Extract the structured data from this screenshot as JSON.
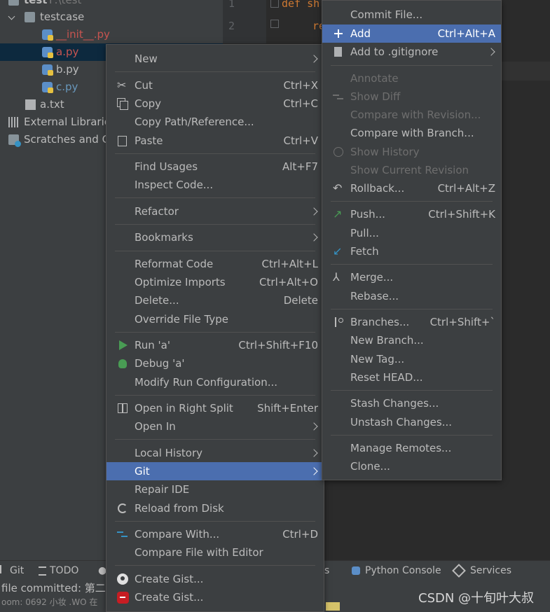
{
  "tree": {
    "root_label": "test",
    "root_path": "F:\\test",
    "folder": "testcase",
    "files": [
      {
        "name": "__init__.py",
        "color": "#c75450"
      },
      {
        "name": "a.py",
        "color": "#c75450"
      },
      {
        "name": "b.py",
        "color": "#bbbbbb"
      },
      {
        "name": "c.py",
        "color": "#6897bb"
      }
    ],
    "txt_file": "a.txt",
    "external": "External Libraries",
    "scratches": "Scratches and Consoles"
  },
  "editor": {
    "lines": [
      "1",
      "2"
    ],
    "code_line1": "def sh",
    "code_line2": "re"
  },
  "context_menu": {
    "items": [
      {
        "label": "New",
        "shortcut": "",
        "submenu": true
      },
      {
        "label": "Cut",
        "shortcut": "Ctrl+X",
        "icon": "scissors-icon"
      },
      {
        "label": "Copy",
        "shortcut": "Ctrl+C",
        "icon": "copy-icon"
      },
      {
        "label": "Copy Path/Reference...",
        "shortcut": ""
      },
      {
        "label": "Paste",
        "shortcut": "Ctrl+V",
        "icon": "paste-icon"
      },
      {
        "label": "Find Usages",
        "shortcut": "Alt+F7"
      },
      {
        "label": "Inspect Code...",
        "shortcut": ""
      },
      {
        "label": "Refactor",
        "shortcut": "",
        "submenu": true
      },
      {
        "label": "Bookmarks",
        "shortcut": "",
        "submenu": true
      },
      {
        "label": "Reformat Code",
        "shortcut": "Ctrl+Alt+L"
      },
      {
        "label": "Optimize Imports",
        "shortcut": "Ctrl+Alt+O"
      },
      {
        "label": "Delete...",
        "shortcut": "Delete"
      },
      {
        "label": "Override File Type",
        "shortcut": ""
      },
      {
        "label": "Run 'a'",
        "shortcut": "Ctrl+Shift+F10",
        "icon": "run-icon"
      },
      {
        "label": "Debug 'a'",
        "shortcut": "",
        "icon": "debug-icon"
      },
      {
        "label": "Modify Run Configuration...",
        "shortcut": ""
      },
      {
        "label": "Open in Right Split",
        "shortcut": "Shift+Enter",
        "icon": "split-icon"
      },
      {
        "label": "Open In",
        "shortcut": "",
        "submenu": true
      },
      {
        "label": "Local History",
        "shortcut": "",
        "submenu": true
      },
      {
        "label": "Git",
        "shortcut": "",
        "submenu": true,
        "highlighted": true
      },
      {
        "label": "Repair IDE",
        "shortcut": ""
      },
      {
        "label": "Reload from Disk",
        "shortcut": "",
        "icon": "reload-icon"
      },
      {
        "label": "Compare With...",
        "shortcut": "Ctrl+D",
        "icon": "compare-icon"
      },
      {
        "label": "Compare File with Editor",
        "shortcut": ""
      },
      {
        "label": "Create Gist...",
        "shortcut": "",
        "icon": "github-icon"
      },
      {
        "label": "Create Gist...",
        "shortcut": "",
        "icon": "gitee-icon"
      }
    ]
  },
  "git_menu": {
    "items": [
      {
        "label": "Commit File...",
        "shortcut": ""
      },
      {
        "label": "Add",
        "shortcut": "Ctrl+Alt+A",
        "icon": "plus-icon",
        "highlighted": true
      },
      {
        "label": "Add to .gitignore",
        "shortcut": "",
        "submenu": true,
        "icon": "gitignore-icon"
      },
      {
        "label": "Annotate",
        "shortcut": "",
        "disabled": true
      },
      {
        "label": "Show Diff",
        "shortcut": "",
        "disabled": true,
        "icon": "diff-icon"
      },
      {
        "label": "Compare with Revision...",
        "shortcut": "",
        "disabled": true
      },
      {
        "label": "Compare with Branch...",
        "shortcut": ""
      },
      {
        "label": "Show History",
        "shortcut": "",
        "disabled": true,
        "icon": "clock-icon"
      },
      {
        "label": "Show Current Revision",
        "shortcut": "",
        "disabled": true
      },
      {
        "label": "Rollback...",
        "shortcut": "Ctrl+Alt+Z",
        "icon": "rollback-icon"
      },
      {
        "label": "Push...",
        "shortcut": "Ctrl+Shift+K",
        "icon": "push-icon"
      },
      {
        "label": "Pull...",
        "shortcut": ""
      },
      {
        "label": "Fetch",
        "shortcut": "",
        "icon": "fetch-icon"
      },
      {
        "label": "Merge...",
        "shortcut": "",
        "icon": "merge-icon"
      },
      {
        "label": "Rebase...",
        "shortcut": ""
      },
      {
        "label": "Branches...",
        "shortcut": "Ctrl+Shift+`",
        "icon": "branch-icon"
      },
      {
        "label": "New Branch...",
        "shortcut": ""
      },
      {
        "label": "New Tag...",
        "shortcut": ""
      },
      {
        "label": "Reset HEAD...",
        "shortcut": ""
      },
      {
        "label": "Stash Changes...",
        "shortcut": ""
      },
      {
        "label": "Unstash Changes...",
        "shortcut": ""
      },
      {
        "label": "Manage Remotes...",
        "shortcut": ""
      },
      {
        "label": "Clone...",
        "shortcut": ""
      }
    ]
  },
  "toolwindows": {
    "git": "Git",
    "todo": "TODO",
    "python_console": "Python Console",
    "services": "Services",
    "fragment": "s"
  },
  "status": {
    "message": "file committed: 第二次",
    "sub": "oom: 0692 小妆 .WO 在"
  },
  "watermark": "CSDN @十旬叶大叔",
  "colors": {
    "accent": "#4b6eaf",
    "background": "#3c3f41",
    "editor": "#2b2b2b",
    "keyword": "#cc7832"
  }
}
